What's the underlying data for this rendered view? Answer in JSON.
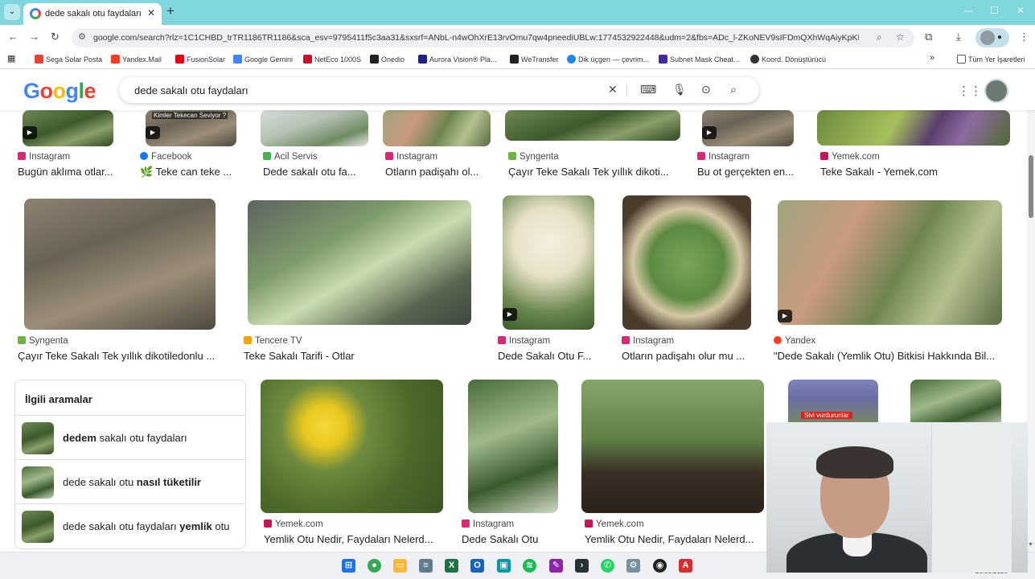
{
  "browser": {
    "tab_title": "dede sakalı otu faydaları - Goog",
    "url": "google.com/search?rlz=1C1CHBD_trTR1186TR1186&sca_esv=9795411f5c3aa31&sxsrf=ANbL-n4wOhXrE13rvOmu7qw4pneediUBLw:1774532922448&udm=2&fbs=ADc_l-ZKoNEV9sIFDmQXhWqAiyKpKEH7Y6z...",
    "bookmarks": [
      {
        "label": "Sega Solar Posta",
        "color": "#ea4335"
      },
      {
        "label": "Yandex.Mail",
        "color": "#fc3f1d"
      },
      {
        "label": "FusionSolar",
        "color": "#e60012"
      },
      {
        "label": "Google Gemini",
        "color": "#4285f4"
      },
      {
        "label": "NetEco 1000S",
        "color": "#c8102e"
      },
      {
        "label": "Onedio",
        "color": "#222222"
      },
      {
        "label": "Aurora Vision® Pla...",
        "color": "#1a237e"
      },
      {
        "label": "WeTransfer",
        "color": "#222222"
      },
      {
        "label": "Dik üçgen — çevrim...",
        "color": "#1e88e5"
      },
      {
        "label": "Subnet Mask Cheat...",
        "color": "#4527a0"
      },
      {
        "label": "Koord. Dönüştürücü",
        "color": "#333333"
      }
    ],
    "all_bookmarks": "Tüm Yer İşaretleri"
  },
  "google": {
    "logo": "Google",
    "query": "dede sakalı otu faydaları"
  },
  "row1": [
    {
      "source": "Instagram",
      "source_color": "#d62976",
      "caption": "Bugün aklıma otlar..."
    },
    {
      "source": "Facebook",
      "source_color": "#1877f2",
      "caption": "🌿 Teke can teke ..."
    },
    {
      "source": "Acil Servis",
      "source_color": "#4caf50",
      "caption": "Dede sakalı otu fa..."
    },
    {
      "source": "Instagram",
      "source_color": "#d62976",
      "caption": "Otların padişahı ol..."
    },
    {
      "source": "Syngenta",
      "source_color": "#6cb33f",
      "caption": "Çayır Teke Sakalı Tek yıllık dikoti..."
    },
    {
      "source": "Instagram",
      "source_color": "#d62976",
      "caption": "Bu ot gerçekten en..."
    },
    {
      "source": "Yemek.com",
      "source_color": "#c2185b",
      "caption": "Teke Sakalı - Yemek.com"
    }
  ],
  "overlay_text": "Kimler Tekecan Seviyor ?",
  "row2": [
    {
      "source": "Syngenta",
      "source_color": "#6cb33f",
      "caption": "Çayır Teke Sakalı Tek yıllık dikotiledonlu ..."
    },
    {
      "source": "Tencere TV",
      "source_color": "#f4a300",
      "caption": "Teke Sakalı Tarifi - Otlar"
    },
    {
      "source": "Instagram",
      "source_color": "#d62976",
      "caption": "Dede Sakalı Otu F..."
    },
    {
      "source": "Instagram",
      "source_color": "#d62976",
      "caption": "Otların padişahı olur mu ..."
    },
    {
      "source": "Yandex",
      "source_color": "#fc3f1d",
      "caption": "\"Dede Sakalı (Yemlik Otu) Bitkisi Hakkında Bil..."
    }
  ],
  "related": {
    "heading": "İlgili aramalar",
    "items": [
      {
        "bold": "dedem",
        "rest": " sakalı otu faydaları",
        "bold_first": true
      },
      {
        "rest": "dede sakalı otu ",
        "bold": "nasıl tüketilir",
        "bold_first": false
      },
      {
        "rest": "dede sakalı otu faydaları ",
        "bold": "yemlik",
        "rest2": " otu",
        "bold_first": false
      }
    ]
  },
  "row3": [
    {
      "source": "Yemek.com",
      "source_color": "#c2185b",
      "caption": "Yemlik Otu Nedir, Faydaları Nelerd..."
    },
    {
      "source": "Instagram",
      "source_color": "#d62976",
      "caption": "Dede Sakalı Otu"
    },
    {
      "source": "Yemek.com",
      "source_color": "#c2185b",
      "caption": "Yemlik Otu Nedir, Faydaları Nelerd..."
    }
  ],
  "row3_badge": "Sivi vurdurunlar",
  "taskbar": {
    "date": "26.03.2026"
  }
}
